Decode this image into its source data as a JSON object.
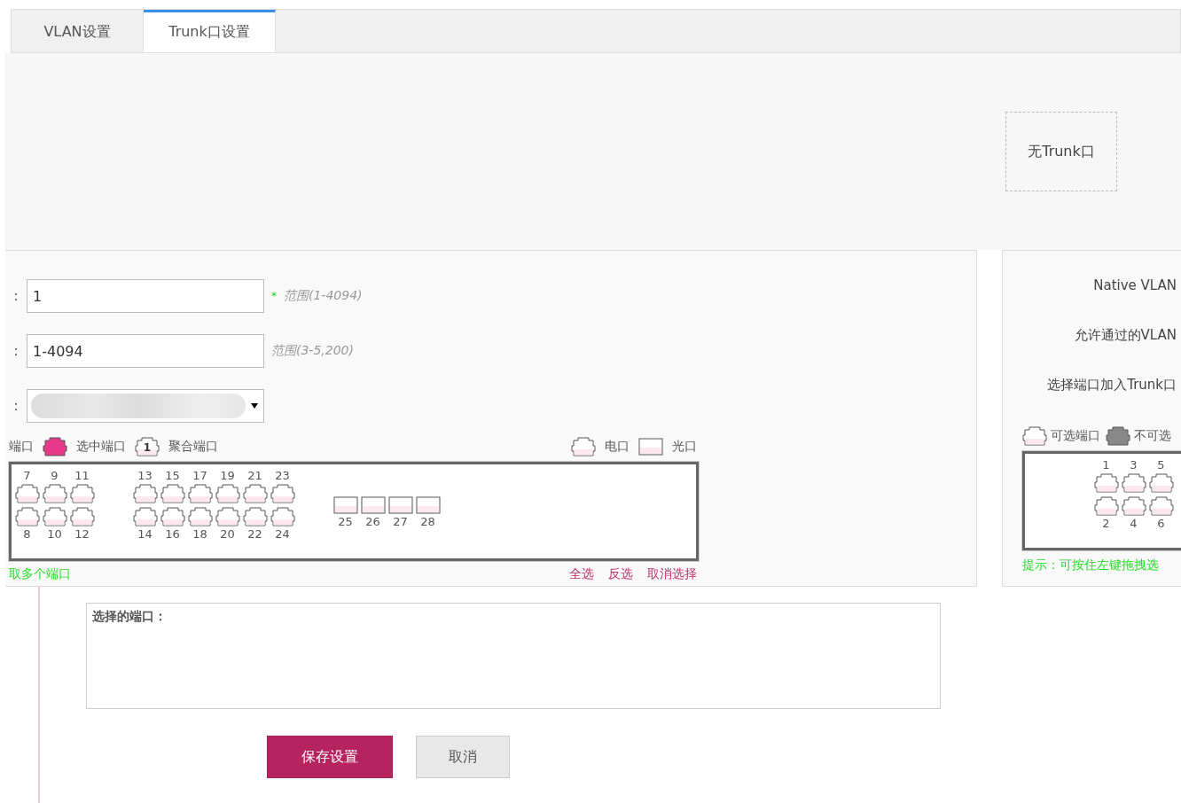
{
  "tabs": [
    {
      "label": "VLAN设置",
      "selected": false
    },
    {
      "label": "Trunk口设置",
      "selected": true
    }
  ],
  "trunk_list": {
    "empty_text": "无Trunk口"
  },
  "form": {
    "fields": [
      {
        "label": "：",
        "value": "1",
        "required_mark": "*",
        "hint": "范围(1-4094)",
        "kind": "input"
      },
      {
        "label": "：",
        "value": "1-4094",
        "hint": "范围(3-5,200)",
        "kind": "input"
      },
      {
        "label": "：",
        "kind": "select"
      }
    ]
  },
  "left_legend": [
    {
      "label": "端口",
      "kind": "none"
    },
    {
      "label": "选中端口",
      "kind": "selected"
    },
    {
      "label": "聚合端口",
      "kind": "aggregate",
      "badge": "1"
    }
  ],
  "type_legend": [
    {
      "label": "电口",
      "kind": "copper"
    },
    {
      "label": "光口",
      "kind": "fiber"
    }
  ],
  "left_ports": {
    "groups": [
      {
        "kind": "copper",
        "top": [
          {
            "number": "7",
            "selected": false
          },
          {
            "number": "9",
            "selected": false
          },
          {
            "number": "11",
            "selected": false
          }
        ],
        "bottom": [
          {
            "number": "8",
            "selected": false
          },
          {
            "number": "10",
            "selected": false
          },
          {
            "number": "12",
            "selected": false
          }
        ]
      },
      {
        "kind": "copper",
        "top": [
          {
            "number": "13",
            "selected": false
          },
          {
            "number": "15",
            "selected": false
          },
          {
            "number": "17",
            "selected": false
          },
          {
            "number": "19",
            "selected": false
          },
          {
            "number": "21",
            "selected": false
          },
          {
            "number": "23",
            "selected": false
          }
        ],
        "bottom": [
          {
            "number": "14",
            "selected": false
          },
          {
            "number": "16",
            "selected": false
          },
          {
            "number": "18",
            "selected": false
          },
          {
            "number": "20",
            "selected": false
          },
          {
            "number": "22",
            "selected": false
          },
          {
            "number": "24",
            "selected": false
          }
        ]
      },
      {
        "kind": "fiber",
        "bottom": [
          {
            "number": "25",
            "selected": false
          },
          {
            "number": "26",
            "selected": false
          },
          {
            "number": "27",
            "selected": false
          },
          {
            "number": "28",
            "selected": false
          }
        ]
      }
    ]
  },
  "left_footer": {
    "hint": "取多个端口",
    "actions": [
      "全选",
      "反选",
      "取消选择"
    ]
  },
  "right_panel": {
    "labels": [
      "Native VLAN",
      "允许通过的VLAN",
      "选择端口加入Trunk口"
    ],
    "legend": [
      {
        "label": "可选端口",
        "kind": "available"
      },
      {
        "label": "不可选",
        "kind": "disabled"
      }
    ],
    "ports": {
      "top": [
        {
          "number": "1",
          "selected": false
        },
        {
          "number": "3",
          "selected": false
        },
        {
          "number": "5",
          "selected": false
        }
      ],
      "bottom": [
        {
          "number": "2",
          "selected": false
        },
        {
          "number": "4",
          "selected": false
        },
        {
          "number": "6",
          "selected": false
        }
      ]
    },
    "hint": "提示：可按住左键拖拽选"
  },
  "selected_ports": {
    "label": "选择的端口："
  },
  "buttons": [
    {
      "label": "保存设置",
      "kind": "primary"
    },
    {
      "label": "取消",
      "kind": "secondary"
    }
  ]
}
